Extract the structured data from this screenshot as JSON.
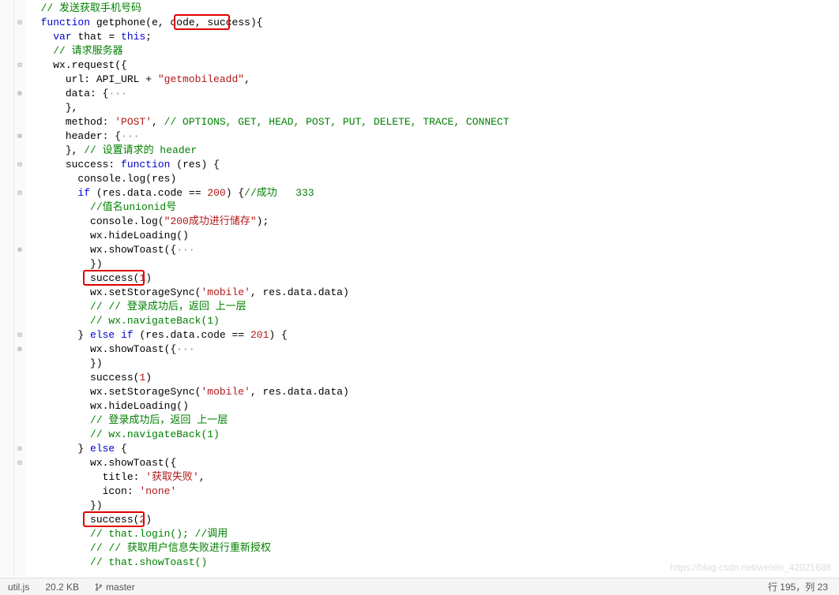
{
  "editor": {
    "lines": [
      {
        "fold": "none",
        "indent": 2,
        "spans": [
          {
            "t": "// 发送获取手机号码",
            "c": "comment"
          }
        ]
      },
      {
        "fold": "minus",
        "indent": 2,
        "spans": [
          {
            "t": "function",
            "c": "kw"
          },
          {
            "t": " ",
            "c": "punct"
          },
          {
            "t": "getphone",
            "c": "ident"
          },
          {
            "t": "(",
            "c": "punct"
          },
          {
            "t": "e",
            "c": "ident"
          },
          {
            "t": ", ",
            "c": "punct"
          },
          {
            "t": "code",
            "c": "ident"
          },
          {
            "t": ", ",
            "c": "punct"
          },
          {
            "t": "success",
            "c": "ident"
          },
          {
            "t": "){",
            "c": "punct"
          }
        ]
      },
      {
        "fold": "none",
        "indent": 4,
        "spans": [
          {
            "t": "var",
            "c": "kw"
          },
          {
            "t": " ",
            "c": "punct"
          },
          {
            "t": "that",
            "c": "ident"
          },
          {
            "t": " = ",
            "c": "punct"
          },
          {
            "t": "this",
            "c": "kw"
          },
          {
            "t": ";",
            "c": "punct"
          }
        ]
      },
      {
        "fold": "none",
        "indent": 4,
        "spans": [
          {
            "t": "// 请求服务器",
            "c": "comment"
          }
        ]
      },
      {
        "fold": "minus",
        "indent": 4,
        "spans": [
          {
            "t": "wx",
            "c": "ident"
          },
          {
            "t": ".",
            "c": "punct"
          },
          {
            "t": "request",
            "c": "ident"
          },
          {
            "t": "({",
            "c": "punct"
          }
        ]
      },
      {
        "fold": "none",
        "indent": 6,
        "spans": [
          {
            "t": "url",
            "c": "ident"
          },
          {
            "t": ": ",
            "c": "punct"
          },
          {
            "t": "API_URL",
            "c": "ident"
          },
          {
            "t": " + ",
            "c": "punct"
          },
          {
            "t": "\"getmobileadd\"",
            "c": "str"
          },
          {
            "t": ",",
            "c": "punct"
          }
        ]
      },
      {
        "fold": "plus",
        "indent": 6,
        "spans": [
          {
            "t": "data",
            "c": "ident"
          },
          {
            "t": ": {",
            "c": "punct"
          },
          {
            "t": "···",
            "c": "ellipsis"
          }
        ]
      },
      {
        "fold": "none",
        "indent": 6,
        "spans": [
          {
            "t": "},",
            "c": "punct"
          }
        ]
      },
      {
        "fold": "none",
        "indent": 6,
        "spans": [
          {
            "t": "method",
            "c": "ident"
          },
          {
            "t": ": ",
            "c": "punct"
          },
          {
            "t": "'POST'",
            "c": "str"
          },
          {
            "t": ", ",
            "c": "punct"
          },
          {
            "t": "// OPTIONS, GET, HEAD, POST, PUT, DELETE, TRACE, CONNECT",
            "c": "comment"
          }
        ]
      },
      {
        "fold": "plus",
        "indent": 6,
        "spans": [
          {
            "t": "header",
            "c": "ident"
          },
          {
            "t": ": {",
            "c": "punct"
          },
          {
            "t": "···",
            "c": "ellipsis"
          }
        ]
      },
      {
        "fold": "none",
        "indent": 6,
        "spans": [
          {
            "t": "}, ",
            "c": "punct"
          },
          {
            "t": "// 设置请求的 header",
            "c": "comment"
          }
        ]
      },
      {
        "fold": "minus",
        "indent": 6,
        "spans": [
          {
            "t": "success",
            "c": "ident"
          },
          {
            "t": ": ",
            "c": "punct"
          },
          {
            "t": "function",
            "c": "kw"
          },
          {
            "t": " (",
            "c": "punct"
          },
          {
            "t": "res",
            "c": "ident"
          },
          {
            "t": ") {",
            "c": "punct"
          }
        ]
      },
      {
        "fold": "none",
        "indent": 8,
        "spans": [
          {
            "t": "console",
            "c": "ident"
          },
          {
            "t": ".",
            "c": "punct"
          },
          {
            "t": "log",
            "c": "ident"
          },
          {
            "t": "(",
            "c": "punct"
          },
          {
            "t": "res",
            "c": "ident"
          },
          {
            "t": ")",
            "c": "punct"
          }
        ]
      },
      {
        "fold": "minus",
        "indent": 8,
        "spans": [
          {
            "t": "if",
            "c": "kw"
          },
          {
            "t": " (",
            "c": "punct"
          },
          {
            "t": "res",
            "c": "ident"
          },
          {
            "t": ".",
            "c": "punct"
          },
          {
            "t": "data",
            "c": "ident"
          },
          {
            "t": ".",
            "c": "punct"
          },
          {
            "t": "code",
            "c": "ident"
          },
          {
            "t": " == ",
            "c": "punct"
          },
          {
            "t": "200",
            "c": "num"
          },
          {
            "t": ") {",
            "c": "punct"
          },
          {
            "t": "//成功   333",
            "c": "comment"
          }
        ]
      },
      {
        "fold": "none",
        "indent": 10,
        "spans": [
          {
            "t": "//值名unionid号",
            "c": "comment"
          }
        ]
      },
      {
        "fold": "none",
        "indent": 10,
        "spans": [
          {
            "t": "console",
            "c": "ident"
          },
          {
            "t": ".",
            "c": "punct"
          },
          {
            "t": "log",
            "c": "ident"
          },
          {
            "t": "(",
            "c": "punct"
          },
          {
            "t": "\"200成功进行储存\"",
            "c": "str"
          },
          {
            "t": ");",
            "c": "punct"
          }
        ]
      },
      {
        "fold": "none",
        "indent": 10,
        "spans": [
          {
            "t": "wx",
            "c": "ident"
          },
          {
            "t": ".",
            "c": "punct"
          },
          {
            "t": "hideLoading",
            "c": "ident"
          },
          {
            "t": "()",
            "c": "punct"
          }
        ]
      },
      {
        "fold": "plus",
        "indent": 10,
        "spans": [
          {
            "t": "wx",
            "c": "ident"
          },
          {
            "t": ".",
            "c": "punct"
          },
          {
            "t": "showToast",
            "c": "ident"
          },
          {
            "t": "({",
            "c": "punct"
          },
          {
            "t": "···",
            "c": "ellipsis"
          }
        ]
      },
      {
        "fold": "none",
        "indent": 10,
        "spans": [
          {
            "t": "})",
            "c": "punct"
          }
        ]
      },
      {
        "fold": "none",
        "indent": 10,
        "spans": [
          {
            "t": "success",
            "c": "ident"
          },
          {
            "t": "(",
            "c": "punct"
          },
          {
            "t": "1",
            "c": "num"
          },
          {
            "t": ")",
            "c": "punct"
          }
        ]
      },
      {
        "fold": "none",
        "indent": 10,
        "spans": [
          {
            "t": "wx",
            "c": "ident"
          },
          {
            "t": ".",
            "c": "punct"
          },
          {
            "t": "setStorageSync",
            "c": "ident"
          },
          {
            "t": "(",
            "c": "punct"
          },
          {
            "t": "'mobile'",
            "c": "str"
          },
          {
            "t": ", ",
            "c": "punct"
          },
          {
            "t": "res",
            "c": "ident"
          },
          {
            "t": ".",
            "c": "punct"
          },
          {
            "t": "data",
            "c": "ident"
          },
          {
            "t": ".",
            "c": "punct"
          },
          {
            "t": "data",
            "c": "ident"
          },
          {
            "t": ")",
            "c": "punct"
          }
        ]
      },
      {
        "fold": "none",
        "indent": 10,
        "spans": [
          {
            "t": "// // 登录成功后，返回 上一层",
            "c": "comment"
          }
        ]
      },
      {
        "fold": "none",
        "indent": 10,
        "spans": [
          {
            "t": "// wx.navigateBack(1)",
            "c": "comment"
          }
        ]
      },
      {
        "fold": "minus",
        "indent": 8,
        "spans": [
          {
            "t": "} ",
            "c": "punct"
          },
          {
            "t": "else",
            "c": "kw"
          },
          {
            "t": " ",
            "c": "punct"
          },
          {
            "t": "if",
            "c": "kw"
          },
          {
            "t": " (",
            "c": "punct"
          },
          {
            "t": "res",
            "c": "ident"
          },
          {
            "t": ".",
            "c": "punct"
          },
          {
            "t": "data",
            "c": "ident"
          },
          {
            "t": ".",
            "c": "punct"
          },
          {
            "t": "code",
            "c": "ident"
          },
          {
            "t": " == ",
            "c": "punct"
          },
          {
            "t": "201",
            "c": "num"
          },
          {
            "t": ") {",
            "c": "punct"
          }
        ]
      },
      {
        "fold": "plus",
        "indent": 10,
        "spans": [
          {
            "t": "wx",
            "c": "ident"
          },
          {
            "t": ".",
            "c": "punct"
          },
          {
            "t": "showToast",
            "c": "ident"
          },
          {
            "t": "({",
            "c": "punct"
          },
          {
            "t": "···",
            "c": "ellipsis"
          }
        ]
      },
      {
        "fold": "none",
        "indent": 10,
        "spans": [
          {
            "t": "})",
            "c": "punct"
          }
        ]
      },
      {
        "fold": "none",
        "indent": 10,
        "spans": [
          {
            "t": "success",
            "c": "ident"
          },
          {
            "t": "(",
            "c": "punct"
          },
          {
            "t": "1",
            "c": "num"
          },
          {
            "t": ")",
            "c": "punct"
          }
        ]
      },
      {
        "fold": "none",
        "indent": 10,
        "spans": [
          {
            "t": "wx",
            "c": "ident"
          },
          {
            "t": ".",
            "c": "punct"
          },
          {
            "t": "setStorageSync",
            "c": "ident"
          },
          {
            "t": "(",
            "c": "punct"
          },
          {
            "t": "'mobile'",
            "c": "str"
          },
          {
            "t": ", ",
            "c": "punct"
          },
          {
            "t": "res",
            "c": "ident"
          },
          {
            "t": ".",
            "c": "punct"
          },
          {
            "t": "data",
            "c": "ident"
          },
          {
            "t": ".",
            "c": "punct"
          },
          {
            "t": "data",
            "c": "ident"
          },
          {
            "t": ")",
            "c": "punct"
          }
        ]
      },
      {
        "fold": "none",
        "indent": 10,
        "spans": [
          {
            "t": "wx",
            "c": "ident"
          },
          {
            "t": ".",
            "c": "punct"
          },
          {
            "t": "hideLoading",
            "c": "ident"
          },
          {
            "t": "()",
            "c": "punct"
          }
        ]
      },
      {
        "fold": "none",
        "indent": 10,
        "spans": [
          {
            "t": "// 登录成功后，返回 上一层",
            "c": "comment"
          }
        ]
      },
      {
        "fold": "none",
        "indent": 10,
        "spans": [
          {
            "t": "// wx.navigateBack(1)",
            "c": "comment"
          }
        ]
      },
      {
        "fold": "minus",
        "indent": 8,
        "spans": [
          {
            "t": "} ",
            "c": "punct"
          },
          {
            "t": "else",
            "c": "kw"
          },
          {
            "t": " {",
            "c": "punct"
          }
        ]
      },
      {
        "fold": "minus",
        "indent": 10,
        "spans": [
          {
            "t": "wx",
            "c": "ident"
          },
          {
            "t": ".",
            "c": "punct"
          },
          {
            "t": "showToast",
            "c": "ident"
          },
          {
            "t": "({",
            "c": "punct"
          }
        ]
      },
      {
        "fold": "none",
        "indent": 12,
        "spans": [
          {
            "t": "title",
            "c": "ident"
          },
          {
            "t": ": ",
            "c": "punct"
          },
          {
            "t": "'获取失败'",
            "c": "str"
          },
          {
            "t": ",",
            "c": "punct"
          }
        ]
      },
      {
        "fold": "none",
        "indent": 12,
        "spans": [
          {
            "t": "icon",
            "c": "ident"
          },
          {
            "t": ": ",
            "c": "punct"
          },
          {
            "t": "'none'",
            "c": "str"
          }
        ]
      },
      {
        "fold": "none",
        "indent": 10,
        "spans": [
          {
            "t": "})",
            "c": "punct"
          }
        ]
      },
      {
        "fold": "none",
        "indent": 10,
        "spans": [
          {
            "t": "success",
            "c": "ident"
          },
          {
            "t": "(",
            "c": "punct"
          },
          {
            "t": "2",
            "c": "num"
          },
          {
            "t": ")",
            "c": "punct"
          }
        ]
      },
      {
        "fold": "none",
        "indent": 10,
        "spans": [
          {
            "t": "// that.login(); //调用",
            "c": "comment"
          }
        ]
      },
      {
        "fold": "none",
        "indent": 10,
        "spans": [
          {
            "t": "// // 获取用户信息失败进行重新授权",
            "c": "comment"
          }
        ]
      },
      {
        "fold": "none",
        "indent": 10,
        "spans": [
          {
            "t": "// that.showToast()",
            "c": "comment"
          }
        ]
      }
    ],
    "highlights": [
      {
        "line_index": 1,
        "char_start": 26,
        "char_end": 35,
        "label": "highlight-success-param"
      },
      {
        "line_index": 19,
        "char_start": 10,
        "char_end": 20,
        "label": "highlight-success-1"
      },
      {
        "line_index": 36,
        "char_start": 10,
        "char_end": 20,
        "label": "highlight-success-2"
      }
    ]
  },
  "statusbar": {
    "filename": "util.js",
    "filesize": "20.2 KB",
    "branch": "master",
    "position": "行 195，列 23"
  },
  "watermark": "https://blog.csdn.net/weixin_42021688"
}
